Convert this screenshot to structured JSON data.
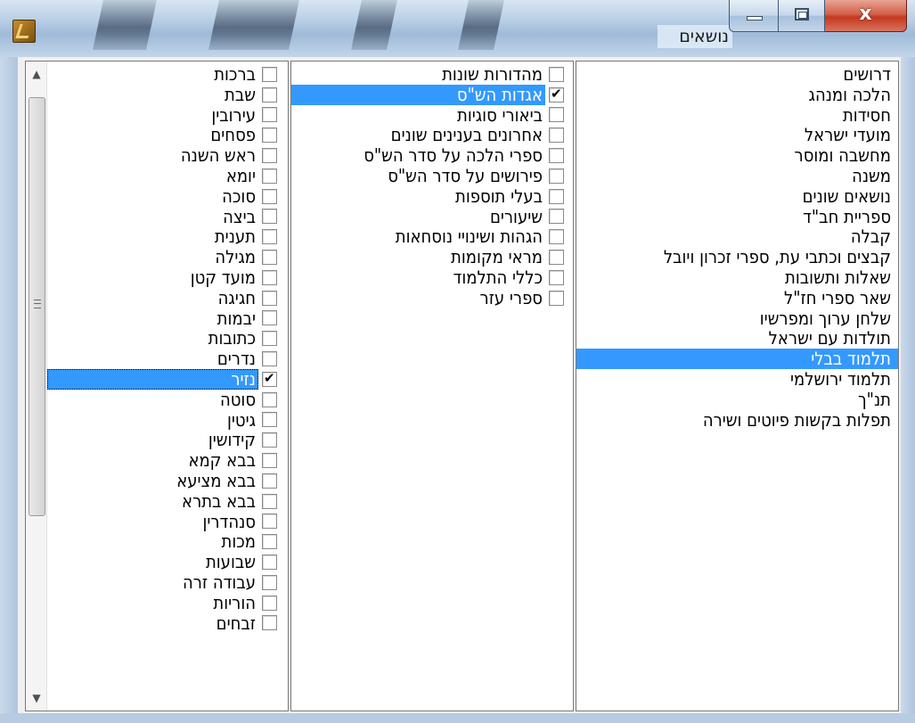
{
  "window": {
    "title": "נושאים",
    "icons": {
      "app": "book-app-icon",
      "minimize": "minimize-icon",
      "maximize": "maximize-icon",
      "close": "close-icon"
    },
    "close_glyph": "x"
  },
  "topics": {
    "items": [
      "דרושים",
      "הלכה ומנהג",
      "חסידות",
      "מועדי ישראל",
      "מחשבה ומוסר",
      "משנה",
      "נושאים שונים",
      "ספריית חב\"ד",
      "קבלה",
      "קבצים וכתבי עת, ספרי זכרון ויובל",
      "שאלות ותשובות",
      "שאר ספרי חז\"ל",
      "שלחן ערוך ומפרשיו",
      "תולדות עם ישראל",
      "תלמוד בבלי",
      "תלמוד ירושלמי",
      "תנ\"ך",
      "תפלות בקשות פיוטים ושירה"
    ],
    "selected_index": 14
  },
  "subtopics": {
    "items": [
      {
        "label": "מהדורות שונות",
        "checked": false
      },
      {
        "label": "אגדות הש\"ס",
        "checked": true,
        "selected": true
      },
      {
        "label": "ביאורי סוגיות",
        "checked": false
      },
      {
        "label": "אחרונים בענינים שונים",
        "checked": false
      },
      {
        "label": "ספרי הלכה על סדר הש\"ס",
        "checked": false
      },
      {
        "label": "פירושים על סדר הש\"ס",
        "checked": false
      },
      {
        "label": "בעלי תוספות",
        "checked": false
      },
      {
        "label": "שיעורים",
        "checked": false
      },
      {
        "label": "הגהות ושינויי נוסחאות",
        "checked": false
      },
      {
        "label": "מראי מקומות",
        "checked": false
      },
      {
        "label": "כללי התלמוד",
        "checked": false
      },
      {
        "label": "ספרי עזר",
        "checked": false
      }
    ]
  },
  "tractates": {
    "items": [
      {
        "label": "ברכות",
        "checked": false
      },
      {
        "label": "שבת",
        "checked": false
      },
      {
        "label": "עירובין",
        "checked": false
      },
      {
        "label": "פסחים",
        "checked": false
      },
      {
        "label": "ראש השנה",
        "checked": false
      },
      {
        "label": "יומא",
        "checked": false
      },
      {
        "label": "סוכה",
        "checked": false
      },
      {
        "label": "ביצה",
        "checked": false
      },
      {
        "label": "תענית",
        "checked": false
      },
      {
        "label": "מגילה",
        "checked": false
      },
      {
        "label": "מועד קטן",
        "checked": false
      },
      {
        "label": "חגיגה",
        "checked": false
      },
      {
        "label": "יבמות",
        "checked": false
      },
      {
        "label": "כתובות",
        "checked": false
      },
      {
        "label": "נדרים",
        "checked": false
      },
      {
        "label": "נזיר",
        "checked": true,
        "selected": true
      },
      {
        "label": "סוטה",
        "checked": false
      },
      {
        "label": "גיטין",
        "checked": false
      },
      {
        "label": "קידושין",
        "checked": false
      },
      {
        "label": "בבא קמא",
        "checked": false
      },
      {
        "label": "בבא מציעא",
        "checked": false
      },
      {
        "label": "בבא בתרא",
        "checked": false
      },
      {
        "label": "סנהדרין",
        "checked": false
      },
      {
        "label": "מכות",
        "checked": false
      },
      {
        "label": "שבועות",
        "checked": false
      },
      {
        "label": "עבודה זרה",
        "checked": false
      },
      {
        "label": "הוריות",
        "checked": false
      },
      {
        "label": "זבחים",
        "checked": false
      }
    ],
    "scrollbar": {
      "up_icon": "scroll-up-arrow-icon",
      "down_icon": "scroll-down-arrow-icon",
      "up_glyph": "▲",
      "down_glyph": "▼"
    }
  },
  "colors": {
    "selection": "#3399ff",
    "selection_text": "#ffffff"
  }
}
